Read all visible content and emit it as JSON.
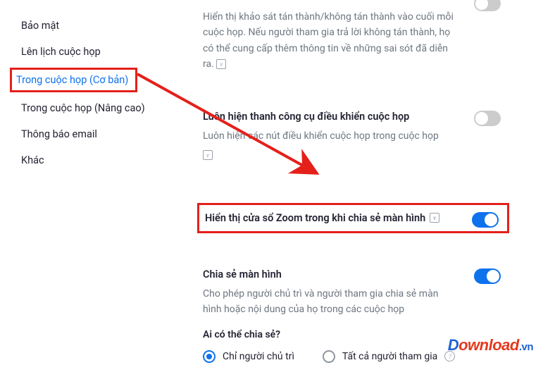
{
  "sidebar": {
    "items": [
      {
        "label": "Bảo mật"
      },
      {
        "label": "Lên lịch cuộc họp"
      },
      {
        "label": "Trong cuộc họp (Cơ bản)"
      },
      {
        "label": "Trong cuộc họp (Nâng cao)"
      },
      {
        "label": "Thông báo email"
      },
      {
        "label": "Khác"
      }
    ]
  },
  "settings": {
    "survey": {
      "desc": "Hiển thị khảo sát tán thành/không tán thành vào cuối mỗi cuộc họp. Nếu người tham gia trả lời không tán thành, họ có thể cung cấp thêm thông tin về những sai sót đã diễn ra."
    },
    "toolbar": {
      "title": "Luôn hiện thanh công cụ điều khiển cuộc họp",
      "desc": "Luôn hiện các nút điều khiển cuộc họp trong cuộc họp"
    },
    "showZoom": {
      "title": "Hiển thị cửa sổ Zoom trong khi chia sẻ màn hình"
    },
    "screenShare": {
      "title": "Chia sẻ màn hình",
      "desc": "Cho phép người chủ trì và người tham gia chia sẻ màn hình hoặc nội dung của họ trong các cuộc họp",
      "who": "Ai có thể chia sẻ?",
      "opt1": "Chỉ người chủ trì",
      "opt2": "Tất cả người tham gia"
    }
  },
  "watermark": {
    "d": "D",
    "own": "ownload",
    "vn": ".vn"
  },
  "icons": {
    "info": "v",
    "help": "?"
  }
}
